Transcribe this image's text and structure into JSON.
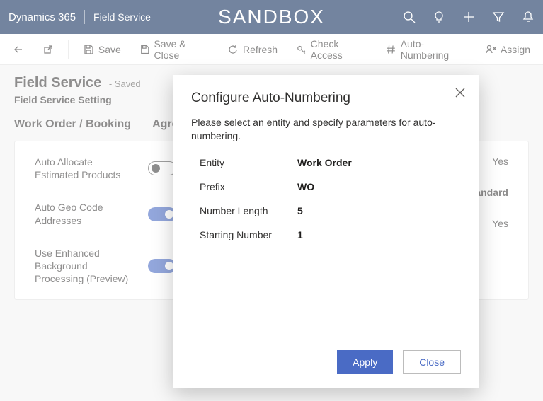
{
  "topbar": {
    "brand": "Dynamics 365",
    "app": "Field Service",
    "env": "SANDBOX"
  },
  "cmdbar": {
    "save": "Save",
    "save_close": "Save & Close",
    "refresh": "Refresh",
    "check_access": "Check Access",
    "auto_numbering": "Auto-Numbering",
    "assign": "Assign"
  },
  "page": {
    "title": "Field Service",
    "status": "- Saved",
    "subtitle": "Field Service Setting",
    "tabs": [
      "Work Order / Booking",
      "Agre"
    ]
  },
  "form": {
    "left": [
      {
        "label": "Auto Allocate Estimated Products",
        "toggle": "off"
      },
      {
        "label": "Auto Geo Code Addresses",
        "toggle": "on"
      },
      {
        "label": "Use Enhanced Background Processing (Preview)",
        "toggle": "on"
      }
    ],
    "right": [
      {
        "value": "Yes"
      },
      {
        "value": "/Standard"
      },
      {
        "value": "Yes"
      }
    ]
  },
  "dialog": {
    "title": "Configure Auto-Numbering",
    "description": "Please select an entity and specify parameters for auto-numbering.",
    "fields": {
      "entity_label": "Entity",
      "entity_value": "Work Order",
      "prefix_label": "Prefix",
      "prefix_value": "WO",
      "length_label": "Number Length",
      "length_value": "5",
      "start_label": "Starting Number",
      "start_value": "1"
    },
    "apply": "Apply",
    "close": "Close"
  }
}
